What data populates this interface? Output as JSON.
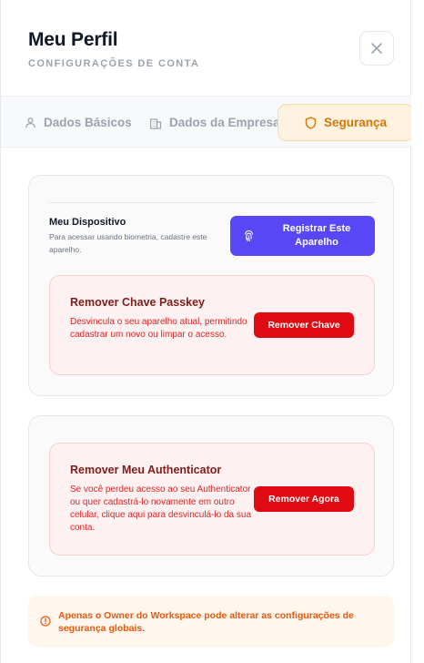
{
  "header": {
    "title": "Meu Perfil",
    "subtitle": "CONFIGURAÇÕES DE CONTA",
    "close_icon": "close-icon"
  },
  "tabs": [
    {
      "label": "Dados Básicos",
      "icon": "user-icon",
      "active": false
    },
    {
      "label": "Dados da Empresa",
      "icon": "building-icon",
      "active": false
    },
    {
      "label": "Segurança",
      "icon": "shield-icon",
      "active": true
    }
  ],
  "device": {
    "title": "Meu Dispositivo",
    "description": "Para acessar usando biometria, cadastre este aparelho.",
    "button_label": "Registrar Este Aparelho",
    "button_icon": "fingerprint-icon"
  },
  "passkey": {
    "title": "Remover Chave Passkey",
    "description": "Desvincula o seu aparelho atual, permitindo cadastrar um novo ou limpar o acesso.",
    "button_label": "Remover Chave"
  },
  "authenticator": {
    "title": "Remover Meu Authenticator",
    "description": "Se você perdeu acesso ao seu Authenticator ou quer cadastrá-lo novamente em outro celular, clique aqui para desvinculá-lo da sua conta.",
    "button_label": "Remover Agora"
  },
  "notice": {
    "icon": "info-icon",
    "text": "Apenas o Owner do Workspace pode alterar as configurações de segurança globais."
  },
  "colors": {
    "accent": "#d97706",
    "primary_button": "#5847f6",
    "danger_button": "#e00b12",
    "danger_text": "#dc2626",
    "notice_text": "#ea580c"
  }
}
